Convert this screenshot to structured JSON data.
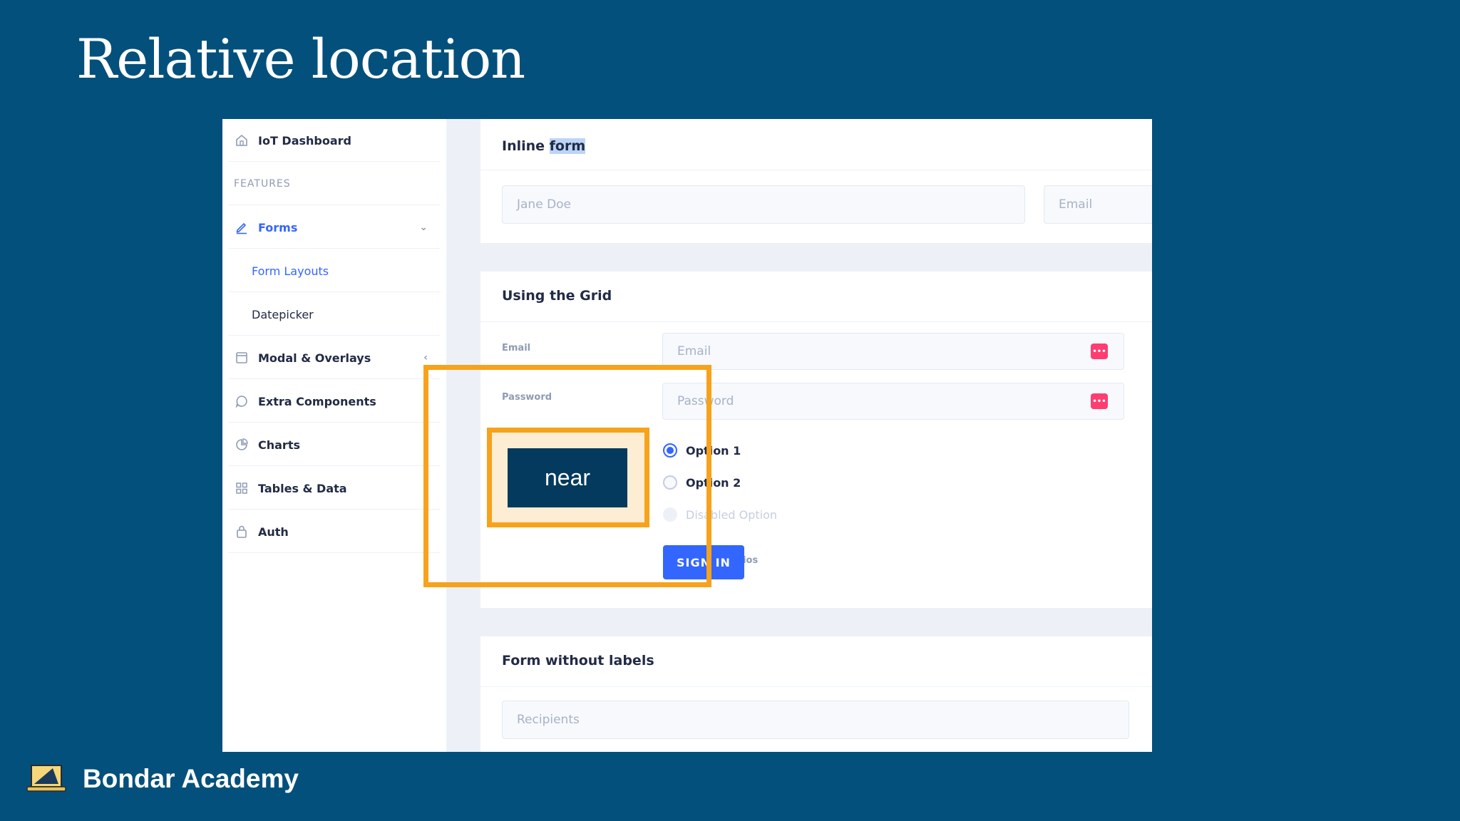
{
  "slide": {
    "title": "Relative location",
    "brand": "Bondar Academy"
  },
  "sidebar": {
    "items": [
      {
        "label": "IoT Dashboard",
        "icon": "home-icon"
      },
      {
        "label": "FEATURES"
      },
      {
        "label": "Forms",
        "icon": "edit-icon"
      },
      {
        "label": "Form Layouts"
      },
      {
        "label": "Datepicker"
      },
      {
        "label": "Modal & Overlays",
        "icon": "browser-icon"
      },
      {
        "label": "Extra Components",
        "icon": "message-icon"
      },
      {
        "label": "Charts",
        "icon": "pie-chart-icon"
      },
      {
        "label": "Tables & Data",
        "icon": "grid-icon"
      },
      {
        "label": "Auth",
        "icon": "lock-icon"
      }
    ]
  },
  "inline_form": {
    "title_prefix": "Inline ",
    "title_highlight": "form",
    "name_placeholder": "Jane Doe",
    "email_placeholder": "Email"
  },
  "grid_form": {
    "title": "Using the Grid",
    "email_label": "Email",
    "email_placeholder": "Email",
    "password_label": "Password",
    "password_placeholder": "Password",
    "radios_label": "Radios",
    "options": [
      "Option 1",
      "Option 2",
      "Disabled Option"
    ],
    "selected_option": "Option 1",
    "sign_in": "SIGN IN"
  },
  "no_labels_form": {
    "title": "Form without labels",
    "recipients_placeholder": "Recipients"
  },
  "annotation": {
    "label": "near",
    "color": "#f7a21b"
  },
  "colors": {
    "background": "#04507c",
    "accent": "#3366ff",
    "danger": "#ff3d71"
  }
}
